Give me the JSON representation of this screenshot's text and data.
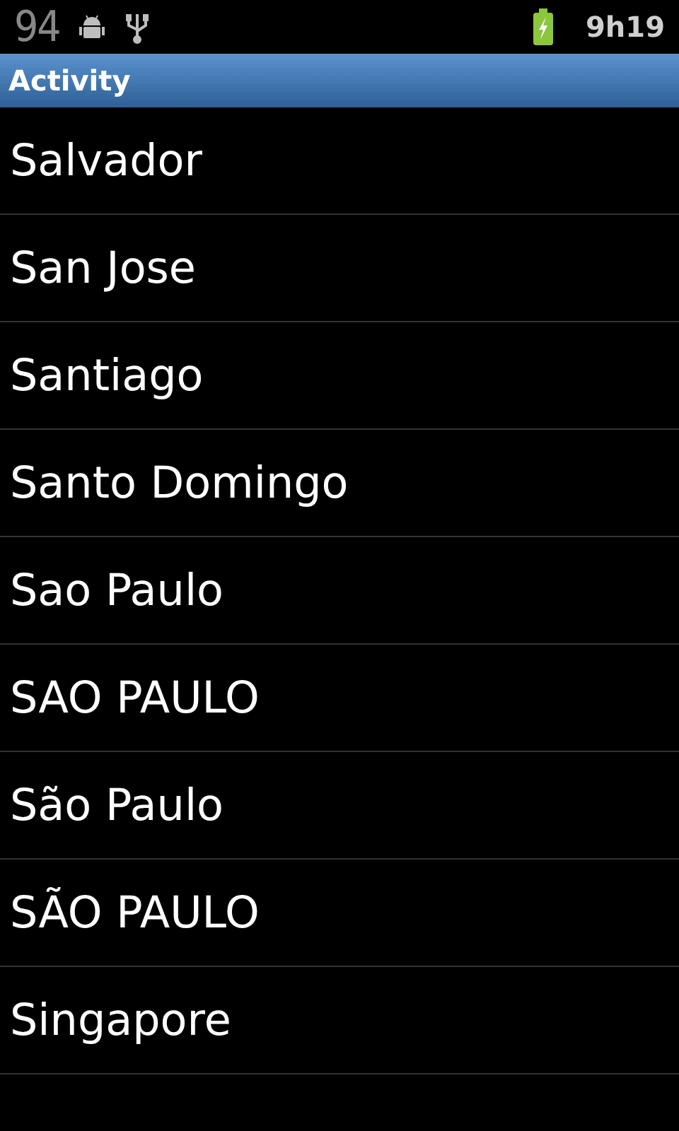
{
  "status_bar": {
    "notification_count": "94",
    "time": "9h19"
  },
  "title_bar": {
    "title": "Activity"
  },
  "list": {
    "items": [
      {
        "label": "Salvador"
      },
      {
        "label": "San Jose"
      },
      {
        "label": "Santiago"
      },
      {
        "label": "Santo Domingo"
      },
      {
        "label": "Sao Paulo"
      },
      {
        "label": "SAO PAULO"
      },
      {
        "label": "São Paulo"
      },
      {
        "label": "SÃO PAULO"
      },
      {
        "label": "Singapore"
      }
    ]
  }
}
